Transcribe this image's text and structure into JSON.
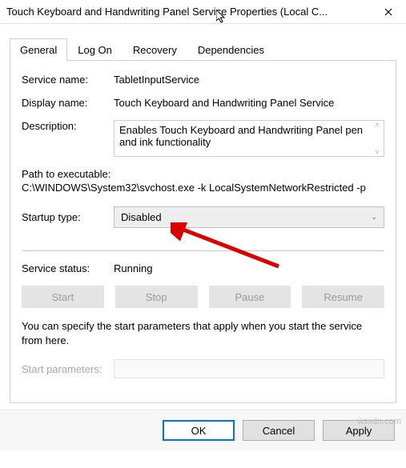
{
  "titlebar": {
    "title": "Touch Keyboard and Handwriting Panel Service Properties (Local C..."
  },
  "tabs": {
    "general": "General",
    "logon": "Log On",
    "recovery": "Recovery",
    "dependencies": "Dependencies"
  },
  "labels": {
    "service_name": "Service name:",
    "display_name": "Display name:",
    "description": "Description:",
    "path_to_exe": "Path to executable:",
    "startup_type": "Startup type:",
    "service_status": "Service status:",
    "start_parameters": "Start parameters:"
  },
  "values": {
    "service_name": "TabletInputService",
    "display_name": "Touch Keyboard and Handwriting Panel Service",
    "description": "Enables Touch Keyboard and Handwriting Panel pen and ink functionality",
    "path_to_exe": "C:\\WINDOWS\\System32\\svchost.exe -k LocalSystemNetworkRestricted -p",
    "startup_type": "Disabled",
    "service_status": "Running"
  },
  "buttons": {
    "start": "Start",
    "stop": "Stop",
    "pause": "Pause",
    "resume": "Resume",
    "ok": "OK",
    "cancel": "Cancel",
    "apply": "Apply"
  },
  "note": "You can specify the start parameters that apply when you start the service from here.",
  "watermark": "wsxdn.com"
}
